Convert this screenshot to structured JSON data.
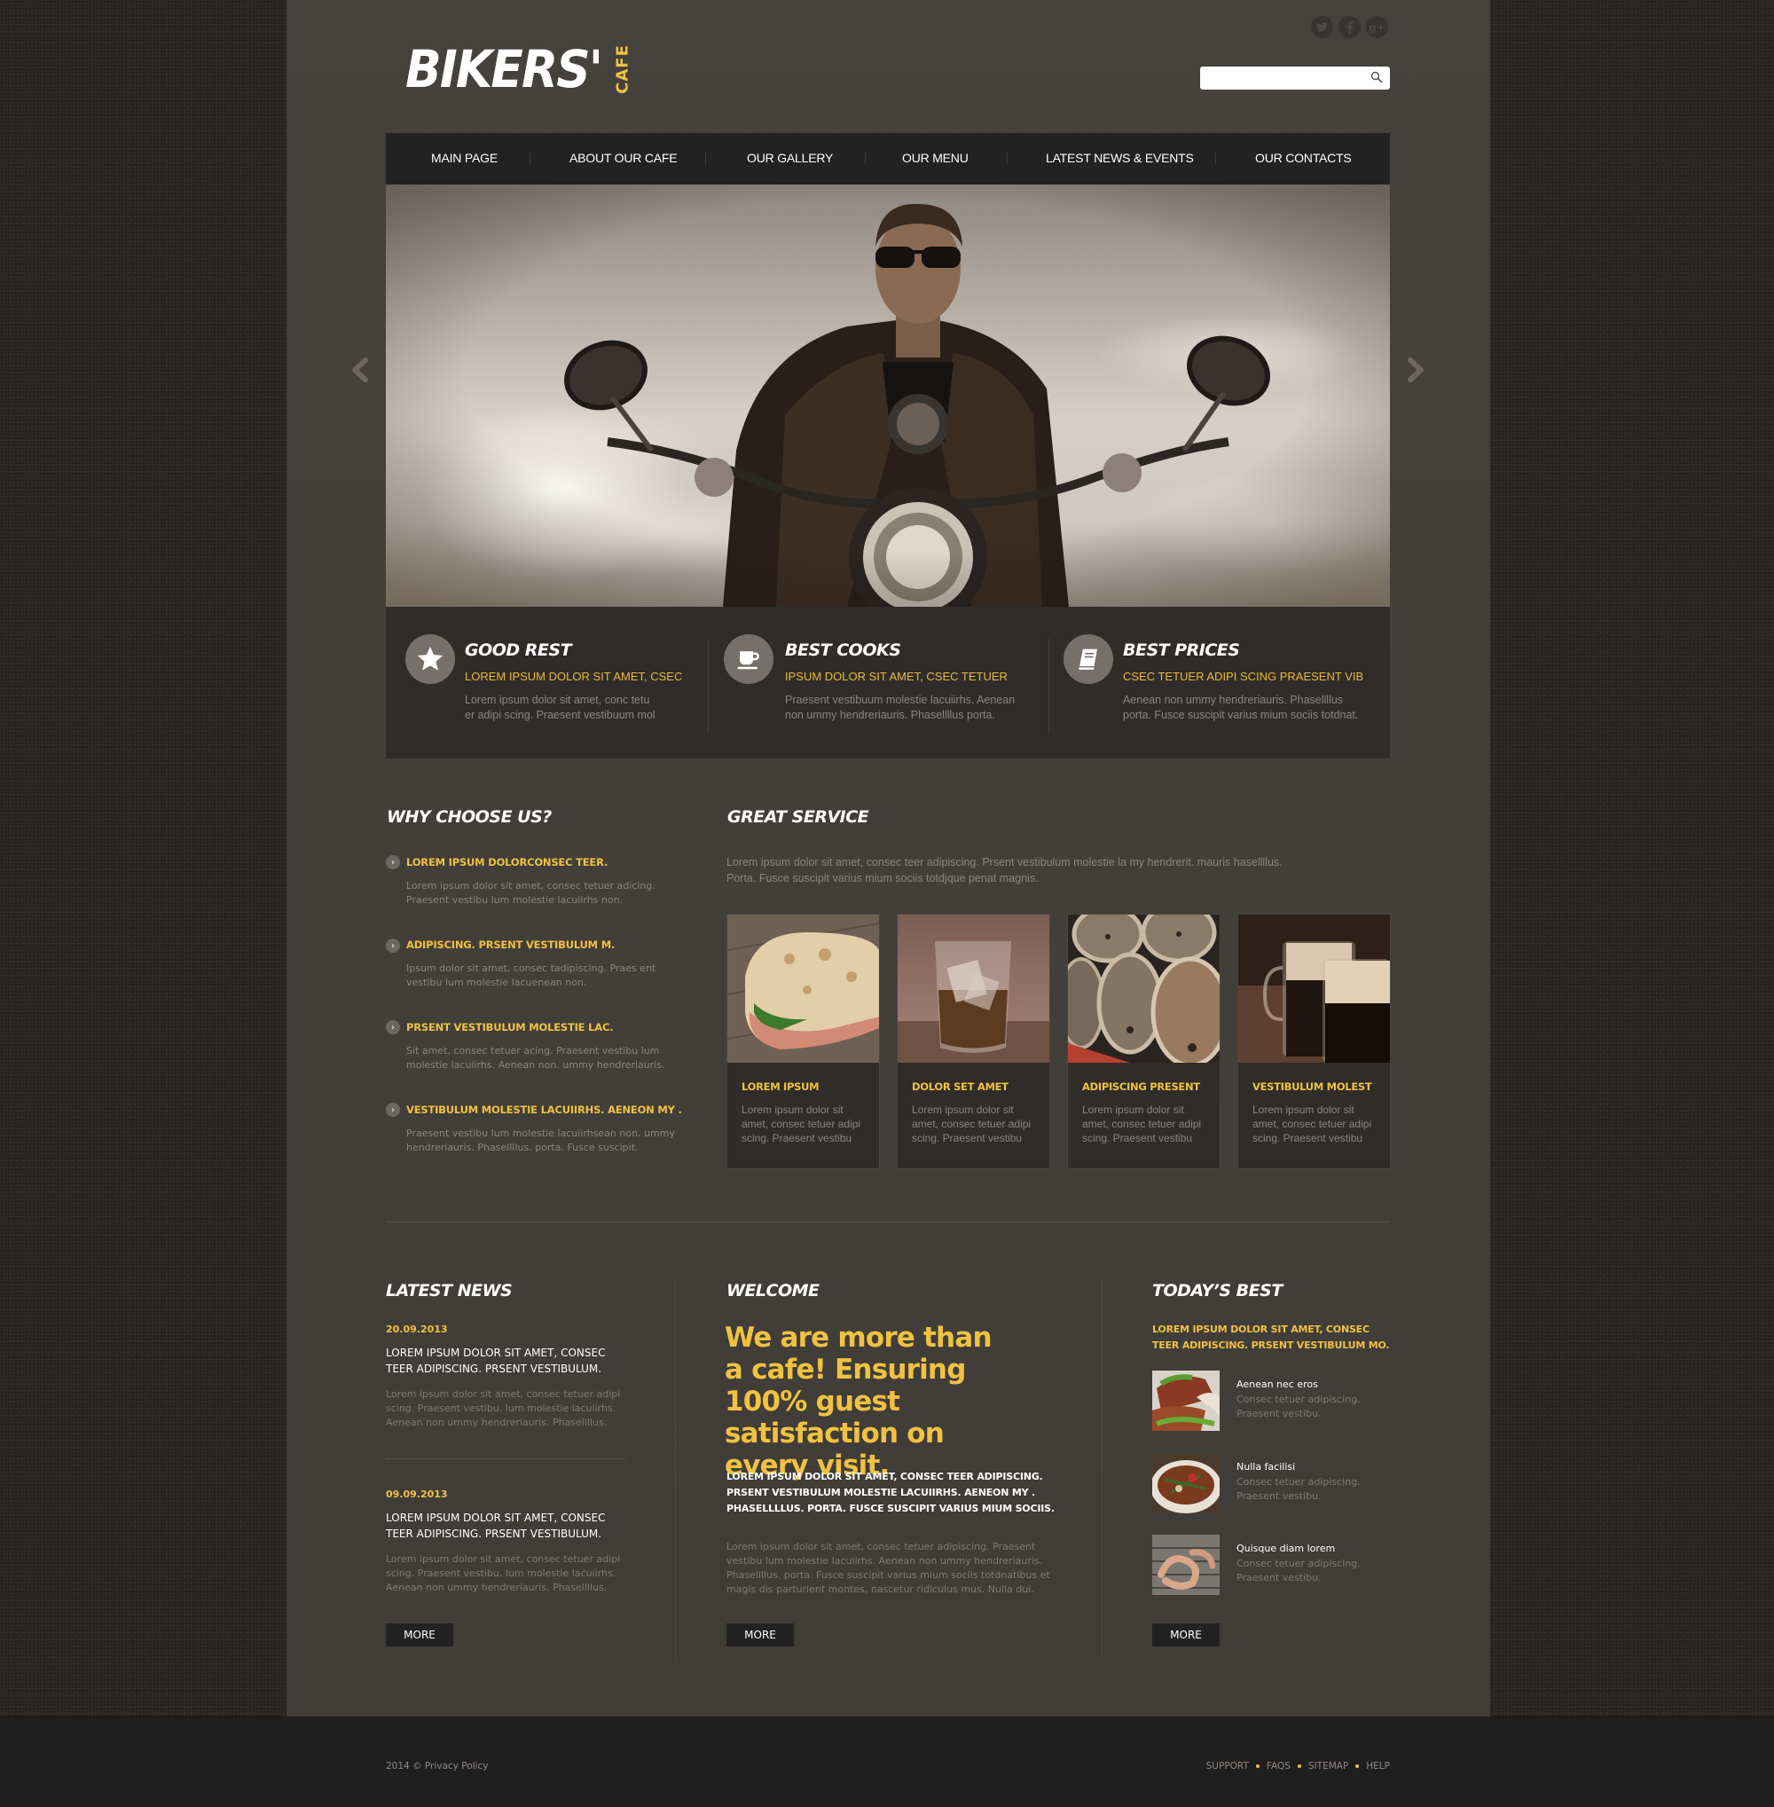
{
  "colors": {
    "accent": "#f0c240",
    "panel": "#423e3a",
    "dark_bar": "#232222",
    "feature_bg": "#302c29",
    "page_bg": "#2b2826",
    "muted_text": "#8b8580"
  },
  "header": {
    "logo_main": "BIKERS'",
    "logo_sub": "CAFE",
    "social": [
      {
        "icon": "twitter-icon",
        "glyph": "t"
      },
      {
        "icon": "facebook-icon",
        "glyph": "f"
      },
      {
        "icon": "google-plus-icon",
        "glyph": "g+"
      }
    ],
    "search": {
      "value": "",
      "placeholder": "",
      "icon": "search-icon"
    }
  },
  "nav": {
    "items": [
      {
        "label": "MAIN PAGE"
      },
      {
        "label": "ABOUT OUR CAFE"
      },
      {
        "label": "OUR GALLERY"
      },
      {
        "label": "OUR MENU"
      },
      {
        "label": "LATEST NEWS & EVENTS"
      },
      {
        "label": "OUR CONTACTS"
      }
    ]
  },
  "slider": {
    "image_alt": "Biker in sunglasses and leather jacket riding motorcycle",
    "prev_icon": "chevron-left-icon",
    "next_icon": "chevron-right-icon"
  },
  "features": [
    {
      "icon": "star-icon",
      "title": "GOOD REST",
      "subtitle": "LOREM IPSUM DOLOR SIT AMET, CSEC",
      "text": "Lorem ipsum dolor sit amet, conc tetu er adipi scing. Praesent vestibuum mol"
    },
    {
      "icon": "coffee-cup-icon",
      "title": "BEST COOKS",
      "subtitle": "IPSUM DOLOR SIT AMET, CSEC TETUER",
      "text": "Praesent vestibuum molestie lacuiirhs. Aenean non ummy hendreriauris. Phasellllus porta."
    },
    {
      "icon": "book-icon",
      "title": "BEST PRICES",
      "subtitle": "CSEC TETUER ADIPI SCING PRAESENT VIB",
      "text": "Aenean non ummy hendreriauris. Phasellllus porta. Fusce suscipit varius mium sociis totdnat."
    }
  ],
  "why_choose": {
    "title": "WHY CHOOSE US?",
    "items": [
      {
        "title": "LOREM IPSUM DOLORCONSEC TEER.",
        "text": "Lorem ipsum dolor sit amet, consec tetuer adicing. Praesent vestibu lum molestie lacuiirhs non."
      },
      {
        "title": "ADIPISCING. PRSENT VESTIBULUM M.",
        "text": "Ipsum dolor sit amet, consec tadipiscing. Praes ent vestibu lum molestie lacuenean non."
      },
      {
        "title": "PRSENT VESTIBULUM MOLESTIE LAC.",
        "text": "Sit amet, consec tetuer acing. Praesent vestibu lum molestie lacuiirhs.  Aenean non. ummy hendreriauris."
      },
      {
        "title": "VESTIBULUM MOLESTIE LACUIIRHS. AENEON MY .",
        "text": "Praesent vestibu lum molestie lacuiirhsean non. ummy hendreriauris. Phasellllus. porta. Fusce suscipit."
      }
    ]
  },
  "great_service": {
    "title": "GREAT SERVICE",
    "intro": "Lorem ipsum dolor sit amet, consec teer adipiscing. Prsent vestibulum molestie la my hendrerit. mauris hasellllus. Porta. Fusce suscipit varius mium sociis totdjque penat magnis.",
    "cards": [
      {
        "image": "focaccia sandwich",
        "title": "LOREM IPSUM",
        "text": "Lorem ipsum dolor sit amet, consec tetuer adipi scing. Praesent vestibu"
      },
      {
        "image": "whiskey glass",
        "title": "DOLOR SET AMET",
        "text": "Lorem ipsum dolor sit amet, consec tetuer adipi scing. Praesent vestibu"
      },
      {
        "image": "wine barrels",
        "title": "ADIPISCING PRESENT",
        "text": "Lorem ipsum dolor sit amet, consec tetuer adipi scing. Praesent vestibu"
      },
      {
        "image": "dark beer mugs",
        "title": "VESTIBULUM MOLEST",
        "text": "Lorem ipsum dolor sit amet, consec tetuer adipi scing. Praesent vestibu"
      }
    ]
  },
  "latest_news": {
    "title": "LATEST NEWS",
    "items": [
      {
        "date": "20.09.2013",
        "title": "LOREM IPSUM DOLOR SIT AMET, CONSEC TEER ADIPISCING. PRSENT VESTIBULUM.",
        "text": "Lorem ipsum dolor sit amet, consec tetuer adipi scing. Praesent vestibu.  lum molestie lacuiirhs. Aenean non ummy hendreriauris. Phasellllus."
      },
      {
        "date": "09.09.2013",
        "title": "LOREM IPSUM DOLOR SIT AMET, CONSEC TEER ADIPISCING. PRSENT VESTIBULUM.",
        "text": "Lorem ipsum dolor sit amet, consec tetuer adipi scing. Praesent vestibu.  lum molestie lacuiirhs. Aenean non ummy hendreriauris. Phasellllus."
      }
    ],
    "more_label": "MORE"
  },
  "welcome": {
    "title": "WELCOME",
    "headline": "We are more than a cafe! Ensuring 100% guest satisfaction on every visit.",
    "caps_text": "LOREM IPSUM DOLOR SIT AMET, CONSEC TEER ADIPISCING. PRSENT VESTIBULUM MOLESTIE LACUIIRHS. AENEON MY . PHASELLLLUS. PORTA. FUSCE SUSCIPIT VARIUS MIUM SOCIIS.",
    "text": "Lorem ipsum dolor sit amet, consec tetuer adipiscing. Praesent vestibu lum molestie lacuiirhs. Aenean non ummy hendreriauris. Phasellllus. porta. Fusce suscipit varius mium sociis totdnatibus et magis dis parturient montes, nascetur ridiculus mus. Nulla dui.",
    "more_label": "MORE"
  },
  "todays_best": {
    "title": "TODAY’S BEST",
    "caps_text": "LOREM IPSUM DOLOR SIT AMET, CONSEC TEER ADIPISCING. PRSENT VESTIBULUM MO.",
    "items": [
      {
        "image": "tacos",
        "name": "Aenean nec eros",
        "desc": "Consec tetuer adipiscing. Praesent vestibu."
      },
      {
        "image": "grilled dish",
        "name": "Nulla facilisi",
        "desc": "Consec tetuer adipiscing. Praesent vestibu."
      },
      {
        "image": "grilled shrimp",
        "name": "Quisque diam lorem",
        "desc": "Consec tetuer adipiscing. Praesent vestibu."
      }
    ],
    "more_label": "MORE"
  },
  "footer": {
    "copyright": "2014 © Privacy Policy",
    "links": [
      {
        "label": "SUPPORT"
      },
      {
        "label": "FAQS"
      },
      {
        "label": "SITEMAP"
      },
      {
        "label": "HELP"
      }
    ]
  }
}
